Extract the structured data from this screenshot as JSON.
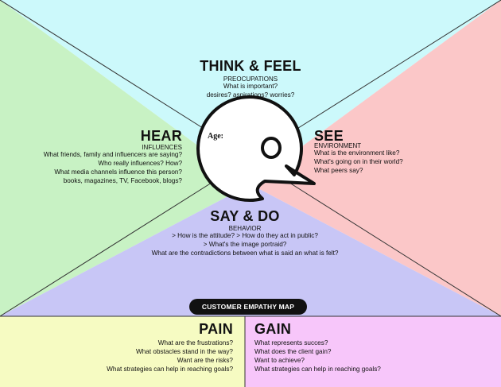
{
  "colors": {
    "think_feel_bg": "#ccf9fb",
    "hear_bg": "#c8f2c4",
    "see_bg": "#fbc7c8",
    "say_do_bg": "#c8c6f6",
    "pain_bg": "#f6fbc2",
    "gain_bg": "#f7c6fa",
    "badge_bg": "#111111"
  },
  "head": {
    "age_label": "Age:"
  },
  "think_feel": {
    "title": "THINK & FEEL",
    "subtitle": "PREOCUPATIONS",
    "lines": [
      "What is important?",
      "desires? aspirations? worries?"
    ]
  },
  "hear": {
    "title": "HEAR",
    "subtitle": "INFLUENCES",
    "lines": [
      "What friends, family and influencers are saying?",
      "Who really influences? How?",
      "What media channels influence this person?",
      "books, magazines, TV, Facebook, blogs?"
    ]
  },
  "see": {
    "title": "SEE",
    "subtitle": "ENVIRONMENT",
    "lines": [
      "What is the environment like?",
      "What's going on in their world?",
      "What peers say?"
    ]
  },
  "say_do": {
    "title": "SAY & DO",
    "subtitle": "BEHAVIOR",
    "lines": [
      "> How is the attitude?  > How do they act in public?",
      "> What's the image portraid?",
      "What are the contradictions between what is said an what is felt?"
    ]
  },
  "badge": {
    "label": "CUSTOMER EMPATHY MAP"
  },
  "pain": {
    "title": "PAIN",
    "lines": [
      "What are the frustrations?",
      "What obstacles stand in the way?",
      "Want are the risks?",
      "What strategies can help in reaching goals?"
    ]
  },
  "gain": {
    "title": "GAIN",
    "lines": [
      "What represents succes?",
      "What does the client gain?",
      "Want to achieve?",
      "What strategies can help in reaching goals?"
    ]
  }
}
